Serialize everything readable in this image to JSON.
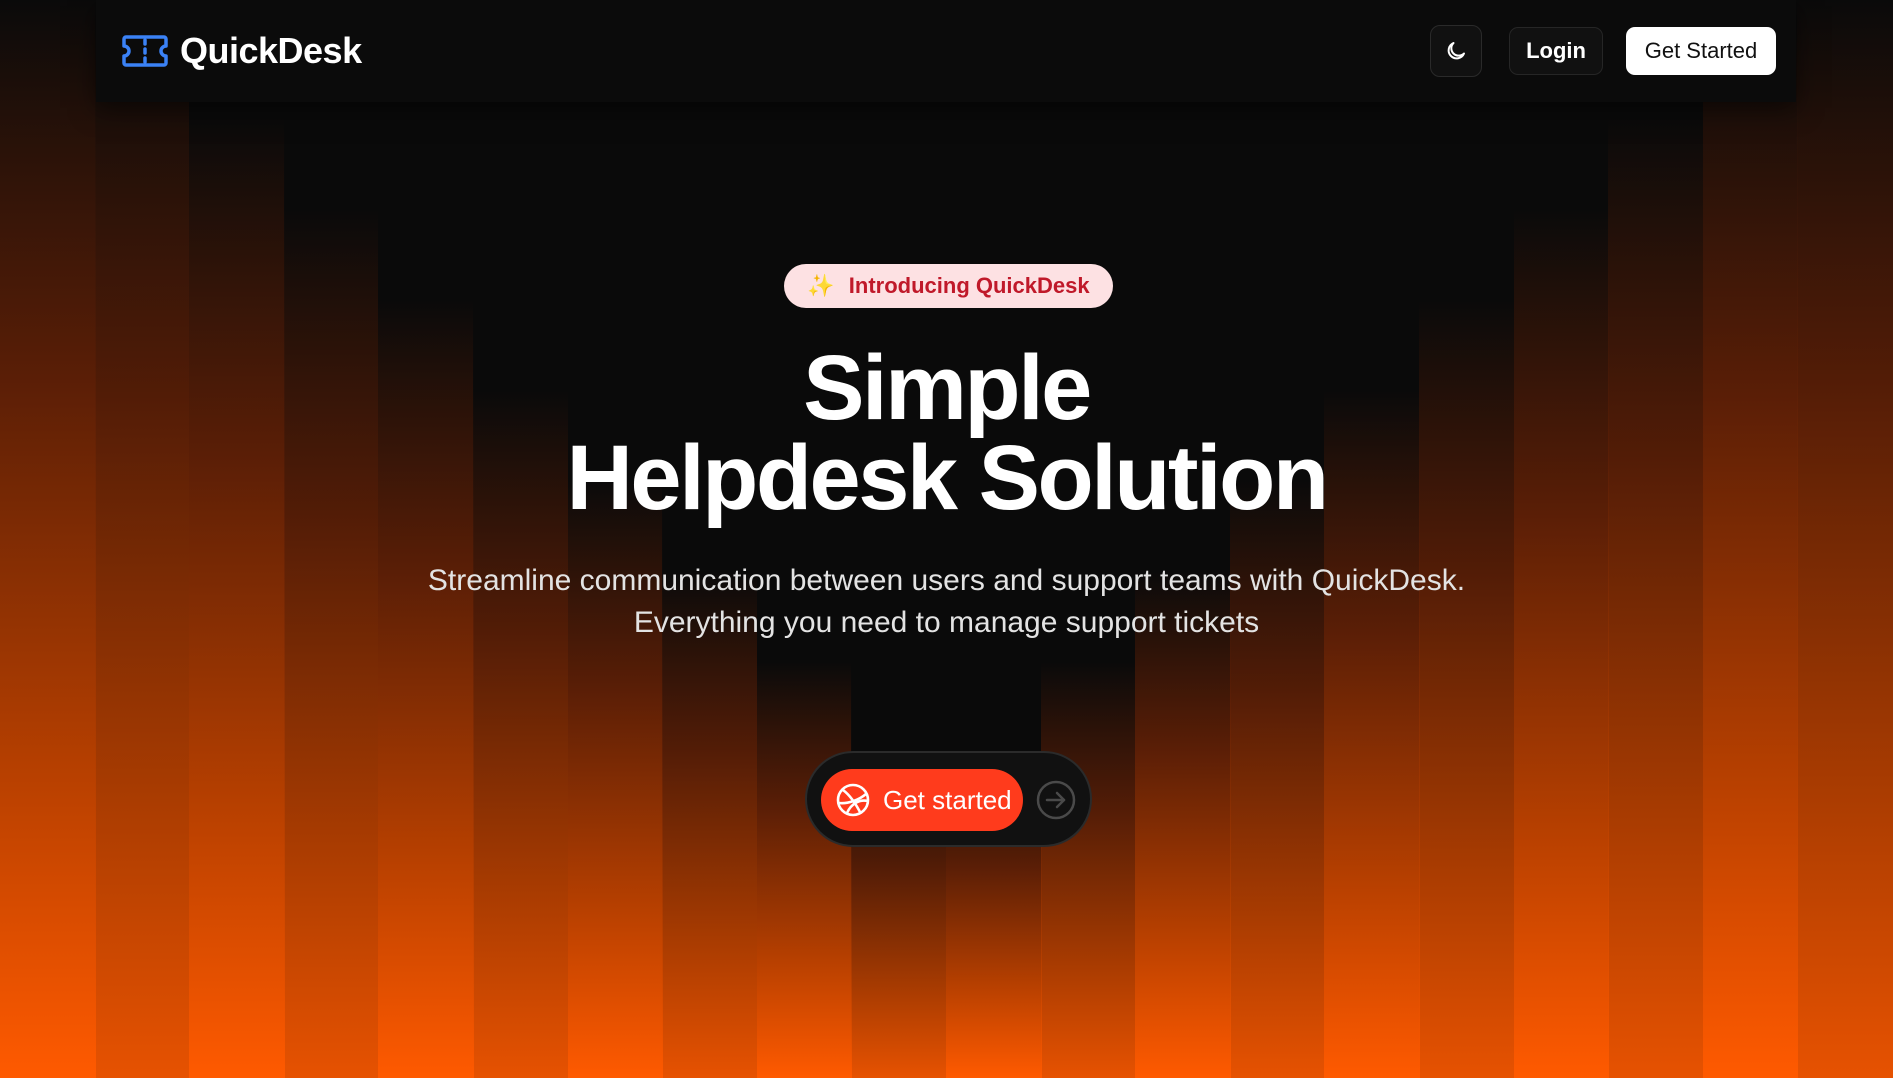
{
  "header": {
    "brand_name": "QuickDesk",
    "brand_icon": "ticket-icon",
    "theme_toggle_icon": "moon-icon",
    "login_label": "Login",
    "get_started_label": "Get Started"
  },
  "hero": {
    "badge_icon": "sparkles-icon",
    "badge_text": "Introducing QuickDesk",
    "title_line_1": "Simple",
    "title_line_2": "Helpdesk Solution",
    "subtitle_line_1": "Streamline communication between users and support teams with QuickDesk.",
    "subtitle_line_2": "Everything you need to manage support tickets",
    "cta_icon": "dribbble-icon",
    "cta_label": "Get started",
    "cta_arrow_icon": "arrow-right-circle-icon"
  },
  "colors": {
    "background": "#0a0a0a",
    "glow_orange": "#ff5a00",
    "brand_blue": "#3b82f6",
    "cta_red": "#ff3b1c",
    "badge_bg": "#fde1e3",
    "badge_text": "#c0192a"
  }
}
